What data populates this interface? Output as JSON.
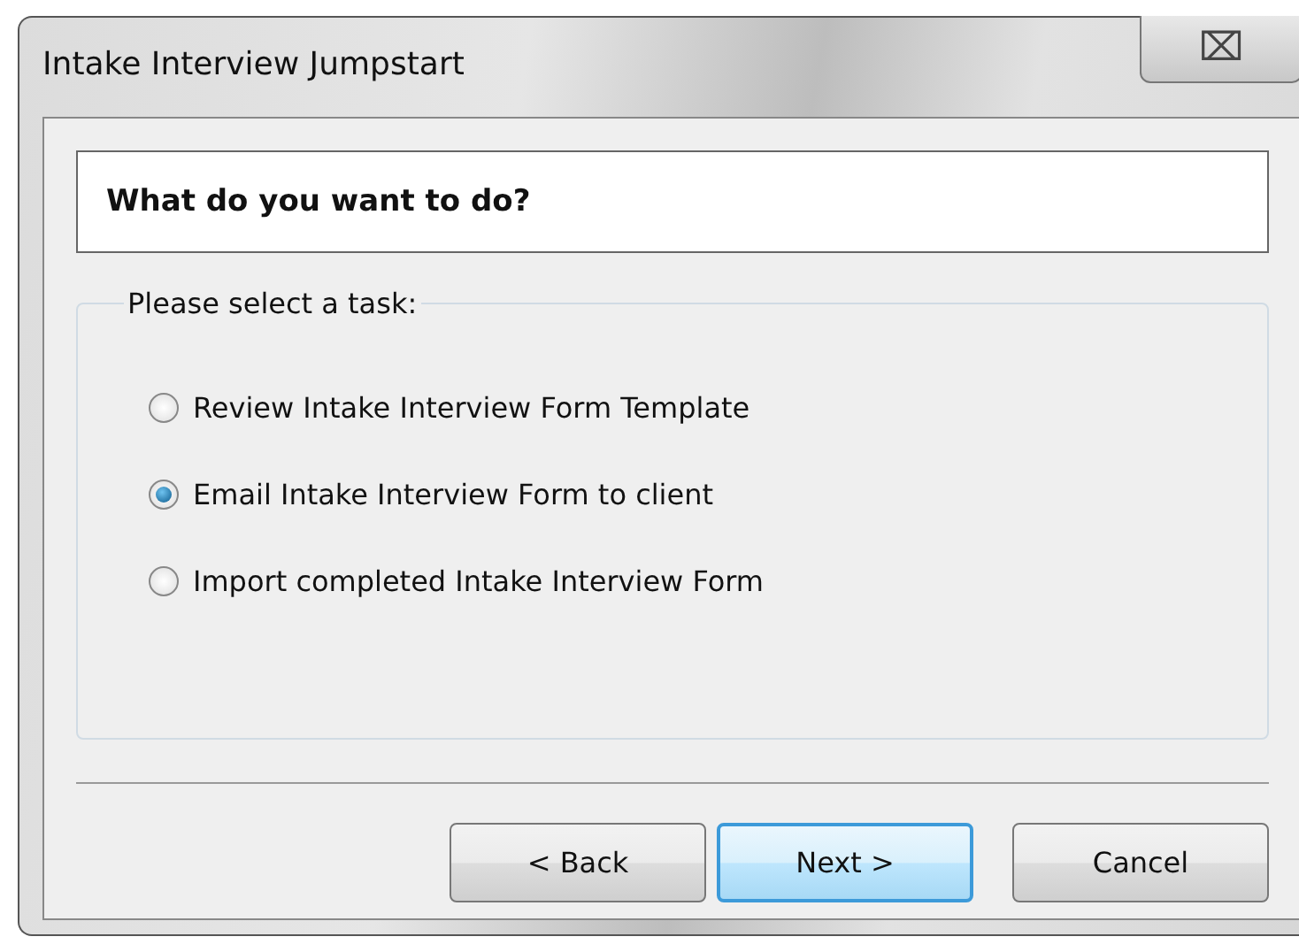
{
  "window": {
    "title": "Intake Interview Jumpstart",
    "close": "⌧"
  },
  "header": {
    "heading": "What do you want to do?"
  },
  "task_group": {
    "label": "Please select a task:",
    "options": [
      {
        "label": "Review Intake Interview Form Template",
        "selected": false
      },
      {
        "label": "Email Intake Interview Form to client",
        "selected": true
      },
      {
        "label": "Import completed Intake Interview Form",
        "selected": false
      }
    ]
  },
  "buttons": [
    {
      "label": "< Back",
      "default": false
    },
    {
      "label": "Next >",
      "default": true
    },
    {
      "label": "Cancel",
      "default": false
    }
  ]
}
